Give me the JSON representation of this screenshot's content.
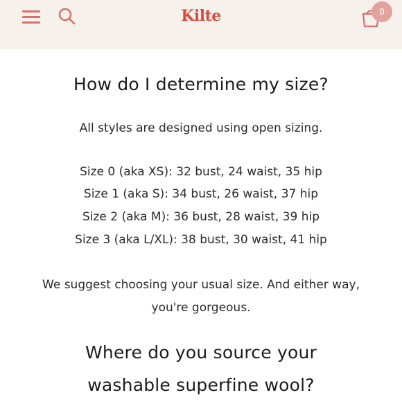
{
  "header": {
    "brand": "Kilte",
    "cart_count": "0"
  },
  "faq": [
    {
      "question": "How do I determine my size?",
      "intro": "All styles are designed using open sizing.",
      "sizes": [
        "Size 0 (aka XS): 32 bust, 24 waist, 35 hip",
        "Size 1 (aka S): 34 bust, 26 waist, 37 hip",
        "Size 2 (aka M): 36 bust, 28 waist, 39 hip",
        "Size 3 (aka L/XL): 38 bust, 30 waist, 41 hip"
      ],
      "note_line1": "We suggest choosing your usual size. And either way,",
      "note_line2": "you're gorgeous."
    },
    {
      "question_line1": "Where do you source your",
      "question_line2": "washable superfine wool?"
    }
  ],
  "colors": {
    "header_bg": "#f7f1ec",
    "accent": "#d96f6a",
    "brand": "#d94c3f",
    "badge": "#e2a39e"
  }
}
